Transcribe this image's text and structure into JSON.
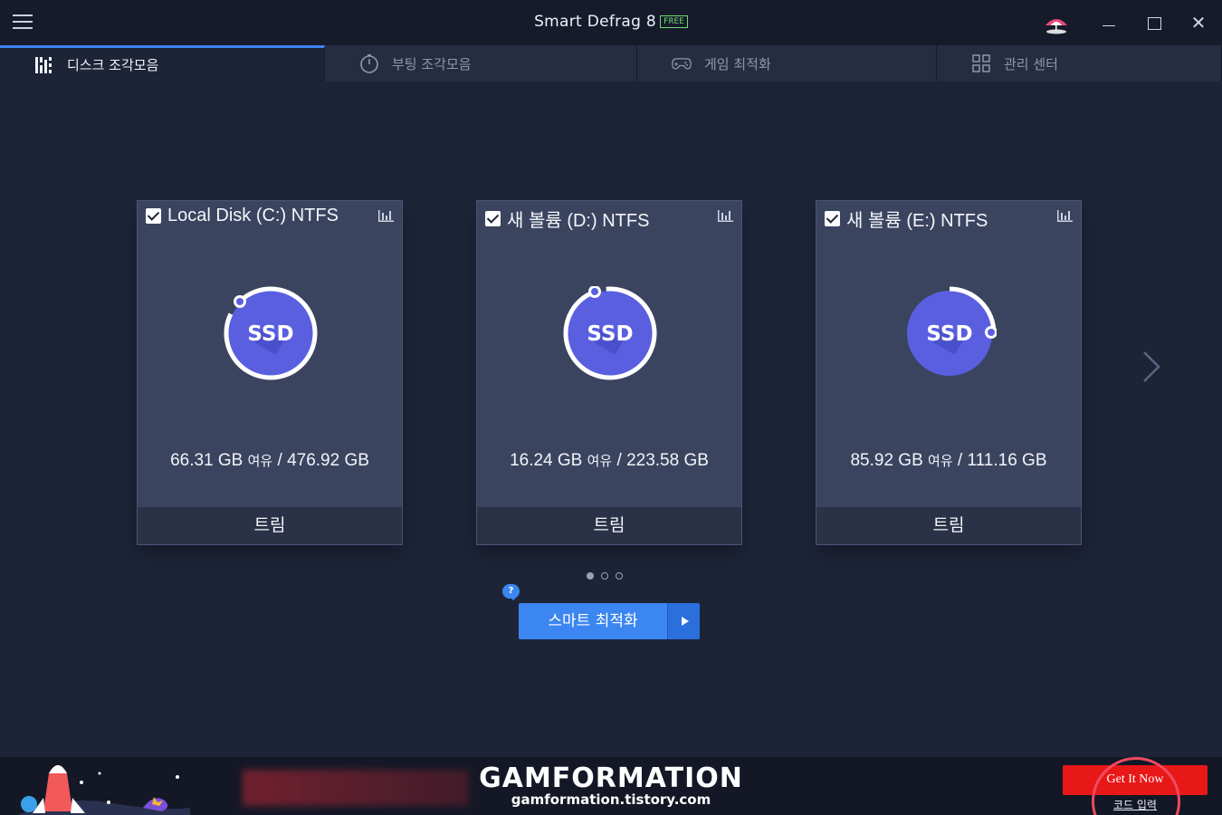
{
  "titlebar": {
    "app_name": "Smart Defrag 8",
    "edition_badge": "FREE"
  },
  "tabs": [
    {
      "label": "디스크 조각모음",
      "icon": "disk-defrag-icon",
      "active": true
    },
    {
      "label": "부팅 조각모음",
      "icon": "boot-timer-icon",
      "active": false
    },
    {
      "label": "게임 최적화",
      "icon": "gamepad-icon",
      "active": false
    },
    {
      "label": "관리 센터",
      "icon": "grid-icon",
      "active": false
    }
  ],
  "disks": [
    {
      "title": "Local Disk (C:) NTFS",
      "badge": "SSD",
      "free": "66.31 GB",
      "free_word": "여유",
      "sep": "/",
      "total": "476.92 GB",
      "action": "트림",
      "checked": true,
      "arc_end": "top-left"
    },
    {
      "title": "새 볼륨 (D:) NTFS",
      "badge": "SSD",
      "free": "16.24 GB",
      "free_word": "여유",
      "sep": "/",
      "total": "223.58 GB",
      "action": "트림",
      "checked": true,
      "arc_end": "top"
    },
    {
      "title": "새 볼륨 (E:) NTFS",
      "badge": "SSD",
      "free": "85.92 GB",
      "free_word": "여유",
      "sep": "/",
      "total": "111.16 GB",
      "action": "트림",
      "checked": true,
      "arc_end": "right"
    }
  ],
  "pager": {
    "pages": 3,
    "current": 1
  },
  "help": {
    "label": "?"
  },
  "optimize": {
    "label": "스마트 최적화"
  },
  "banner": {
    "watermark_title": "GAMFORMATION",
    "watermark_sub": "gamformation.tistory.com",
    "get_it_now": "Get It Now",
    "code_entry": "코드 입력"
  },
  "colors": {
    "background": "#1d2438",
    "card": "#3b445f",
    "accent": "#3c86f1",
    "ssd_disc": "#5a5fe0",
    "get_it_red": "#e81818"
  }
}
